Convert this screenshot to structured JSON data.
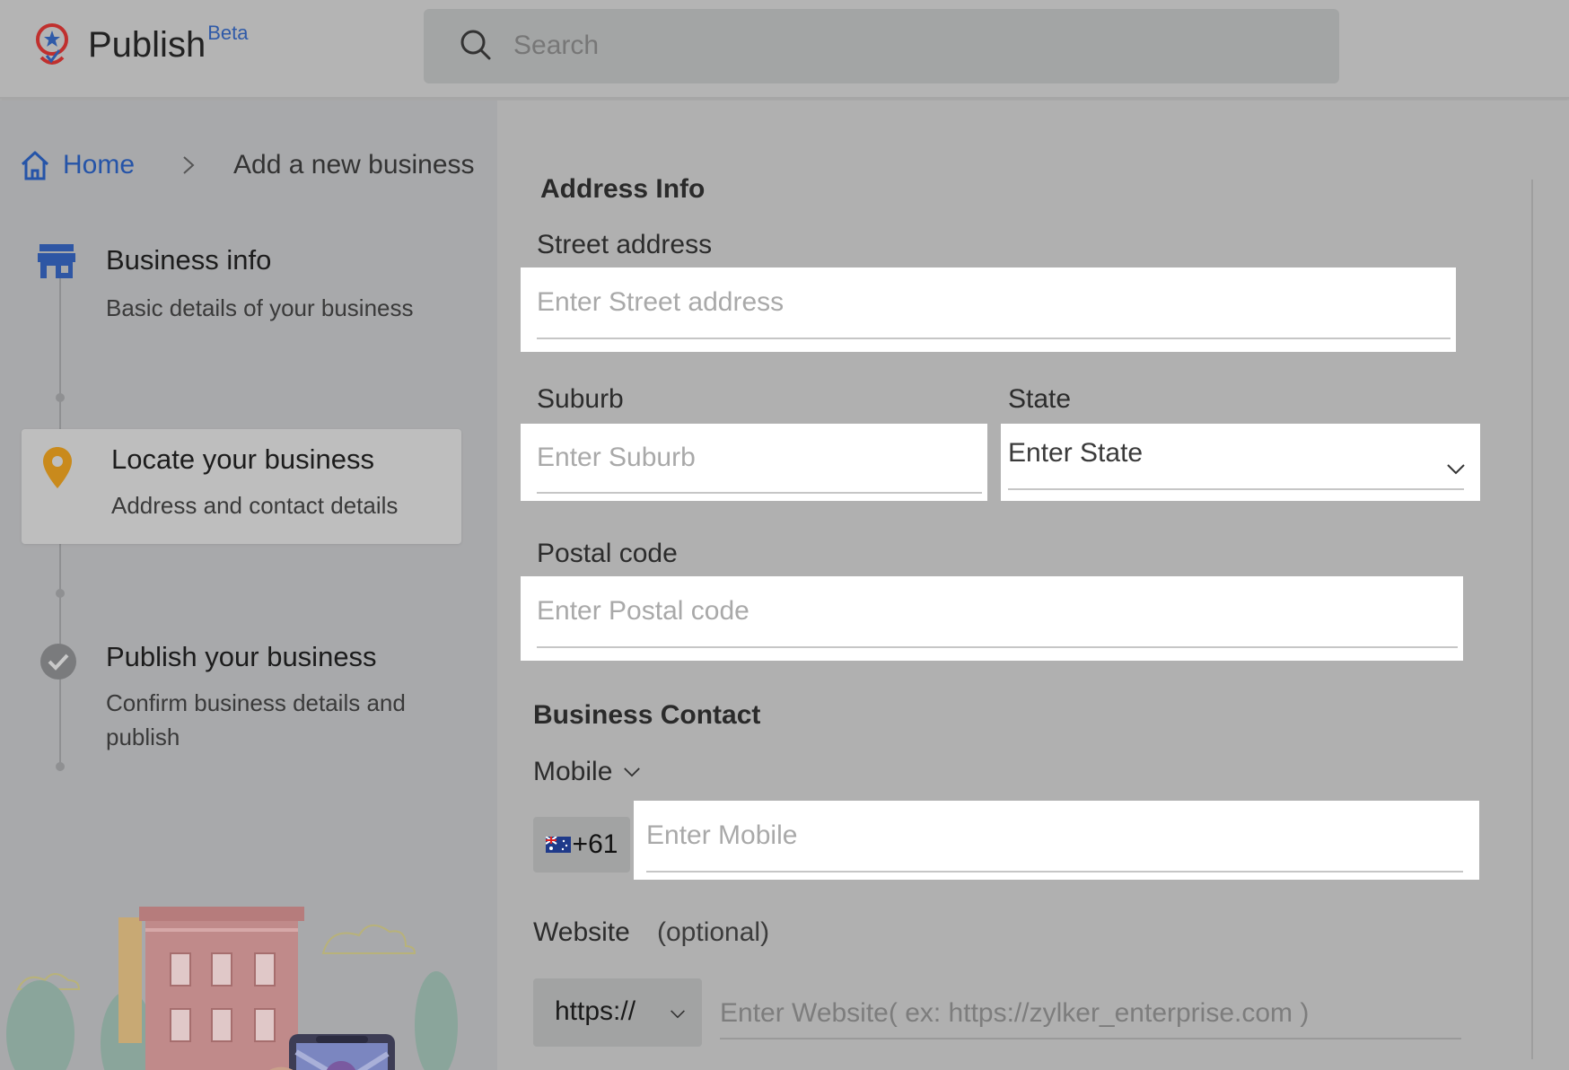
{
  "header": {
    "brand": "Publish",
    "brand_badge": "Beta",
    "search_placeholder": "Search"
  },
  "breadcrumb": {
    "home": "Home",
    "current": "Add a new business"
  },
  "steps": [
    {
      "title": "Business info",
      "desc": "Basic details of your business",
      "icon": "store-icon",
      "state": "done"
    },
    {
      "title": "Locate your business",
      "desc": "Address and contact details",
      "icon": "map-pin-icon",
      "state": "active"
    },
    {
      "title": "Publish your business",
      "desc": "Confirm business details and publish",
      "icon": "check-circle-icon",
      "state": "pending"
    }
  ],
  "address": {
    "heading": "Address Info",
    "street_label": "Street address",
    "street_placeholder": "Enter Street address",
    "suburb_label": "Suburb",
    "suburb_placeholder": "Enter Suburb",
    "state_label": "State",
    "state_value": "Enter State",
    "postal_label": "Postal code",
    "postal_placeholder": "Enter Postal code"
  },
  "contact": {
    "heading": "Business Contact",
    "mobile_label": "Mobile",
    "country_code": "+61",
    "mobile_placeholder": "Enter Mobile",
    "website_label": "Website",
    "website_optional": "(optional)",
    "protocol": "https://",
    "website_placeholder": "Enter Website( ex: https://zylker_enterprise.com )"
  },
  "colors": {
    "accent": "#2554a8",
    "pin": "#c98a1c",
    "overlay_bg": "#b0b0b0"
  }
}
